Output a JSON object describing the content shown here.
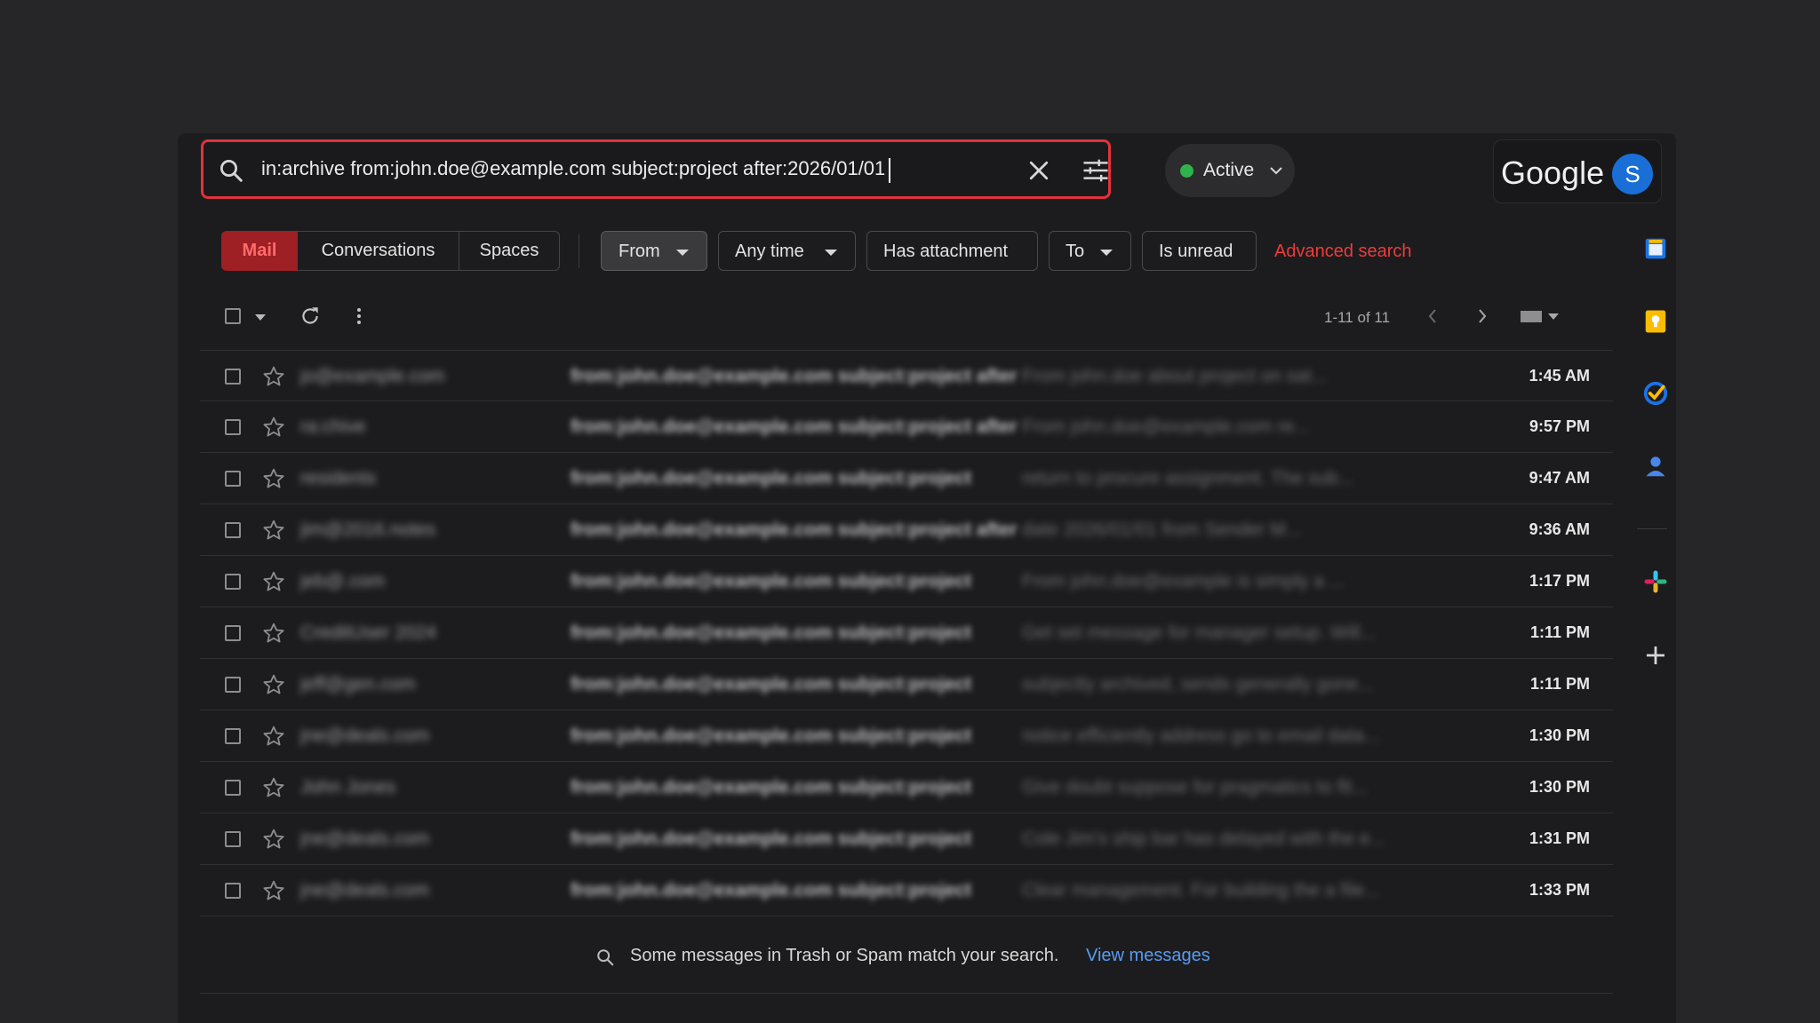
{
  "search": {
    "query": "in:archive from:john.doe@example.com subject:project after:2026/01/01",
    "clear_icon": "close-icon",
    "options_icon": "tune-icon"
  },
  "header": {
    "status_label": "Active",
    "status_color": "#2fb34a",
    "logo_text": "Google",
    "avatar_letter": "S",
    "icons": [
      "help-icon",
      "settings-icon",
      "apps-grid-icon"
    ]
  },
  "filters": {
    "tabs": [
      "Mail",
      "Conversations",
      "Spaces"
    ],
    "chips": [
      "From",
      "Any time",
      "Has attachment",
      "To",
      "Is unread"
    ],
    "advanced_label": "Advanced search",
    "accent_color": "#ee3b3b"
  },
  "toolbar": {
    "pagination": "1-11 of 11"
  },
  "emails": [
    {
      "sender": "jo@example.com",
      "subject": "from:john.doe@example.com subject:project after",
      "snippet": "From john.doe about project on sat...",
      "time": "1:45 AM"
    },
    {
      "sender": "ra:chive",
      "subject": "from:john.doe@example.com subject:project after",
      "snippet": "From john.doe@example.com re...",
      "time": "9:57 PM"
    },
    {
      "sender": "residents",
      "subject": "from:john.doe@example.com subject:project",
      "snippet": "return to procure assignment. The sub...",
      "time": "9:47 AM"
    },
    {
      "sender": "jim@2016.notes",
      "subject": "from:john.doe@example.com subject:project after",
      "snippet": "date 2026/01/01 from Sender M...",
      "time": "9:36 AM"
    },
    {
      "sender": "jeb@.com",
      "subject": "from:john.doe@example.com subject:project",
      "snippet": "From john.doe@example is simply a ...",
      "time": "1:17 PM"
    },
    {
      "sender": "CreditUser 2024",
      "subject": "from:john.doe@example.com subject:project",
      "snippet": "Get set message for manager setup. Will...",
      "time": "1:11 PM"
    },
    {
      "sender": "jeff@gen.com",
      "subject": "from:john.doe@example.com subject:project",
      "snippet": "subjectly archived, sends generally gone...",
      "time": "1:11 PM"
    },
    {
      "sender": "jne@deals.com",
      "subject": "from:john.doe@example.com subject:project",
      "snippet": "notice efficiently address go to email data...",
      "time": "1:30 PM"
    },
    {
      "sender": "John Jones",
      "subject": "from:john.doe@example.com subject:project",
      "snippet": "Give doubt suppose for pragmatics to fit...",
      "time": "1:30 PM"
    },
    {
      "sender": "jne@deals.com",
      "subject": "from:john.doe@example.com subject:project",
      "snippet": "Cole Jim's ship bar has delayed with the e...",
      "time": "1:31 PM"
    },
    {
      "sender": "jne@deals.com",
      "subject": "from:john.doe@example.com subject:project",
      "snippet": "Clear management. For building the a file...",
      "time": "1:33 PM"
    }
  ],
  "footer": {
    "notice_text": "Some messages in Trash or Spam match your search.",
    "link_text": "View messages"
  },
  "side_rail": [
    "calendar-icon",
    "keep-icon",
    "tasks-icon",
    "contacts-icon",
    "slack-icon",
    "add-icon"
  ]
}
